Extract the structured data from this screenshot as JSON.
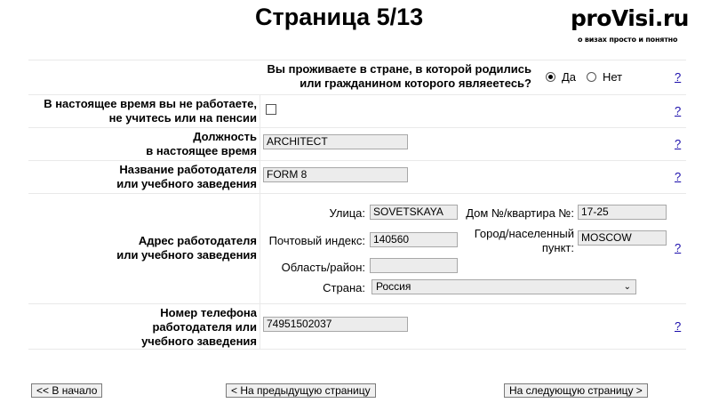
{
  "page": {
    "title": "Страница 5/13"
  },
  "logo": {
    "brand": "proVisi.ru",
    "tagline": "о визах просто и понятно"
  },
  "help_label": "?",
  "q_residence": {
    "label_line1": "Вы проживаете в стране, в которой родились",
    "label_line2": "или гражданином которого являеетесь?",
    "yes": "Да",
    "no": "Нет"
  },
  "q_unemployed": {
    "label_line1": "В настоящее время вы не работаете,",
    "label_line2": "не учитесь или на пенсии"
  },
  "position": {
    "label_line1": "Должность",
    "label_line2": "в настоящее время",
    "value": "ARCHITECT"
  },
  "employer": {
    "label_line1": "Название работодателя",
    "label_line2": "или учебного заведения",
    "value": "FORM 8"
  },
  "address": {
    "label_line1": "Адрес работодателя",
    "label_line2": "или учебного заведения",
    "street_label": "Улица:",
    "street_value": "SOVETSKAYA",
    "house_label": "Дом №/квартира №:",
    "house_value": "17-25",
    "zip_label": "Почтовый индекс:",
    "zip_value": "140560",
    "city_label_line1": "Город/населенный",
    "city_label_line2": "пункт:",
    "city_value": "MOSCOW",
    "region_label": "Область/район:",
    "region_value": "",
    "country_label": "Страна:",
    "country_value": "Россия"
  },
  "phone": {
    "label_line1": "Номер телефона",
    "label_line2": "работодателя или",
    "label_line3": "учебного заведения",
    "value": "74951502037"
  },
  "nav": {
    "start": "<< В начало",
    "prev": "< На предыдущую страницу",
    "next": "На следующую страницу >"
  }
}
